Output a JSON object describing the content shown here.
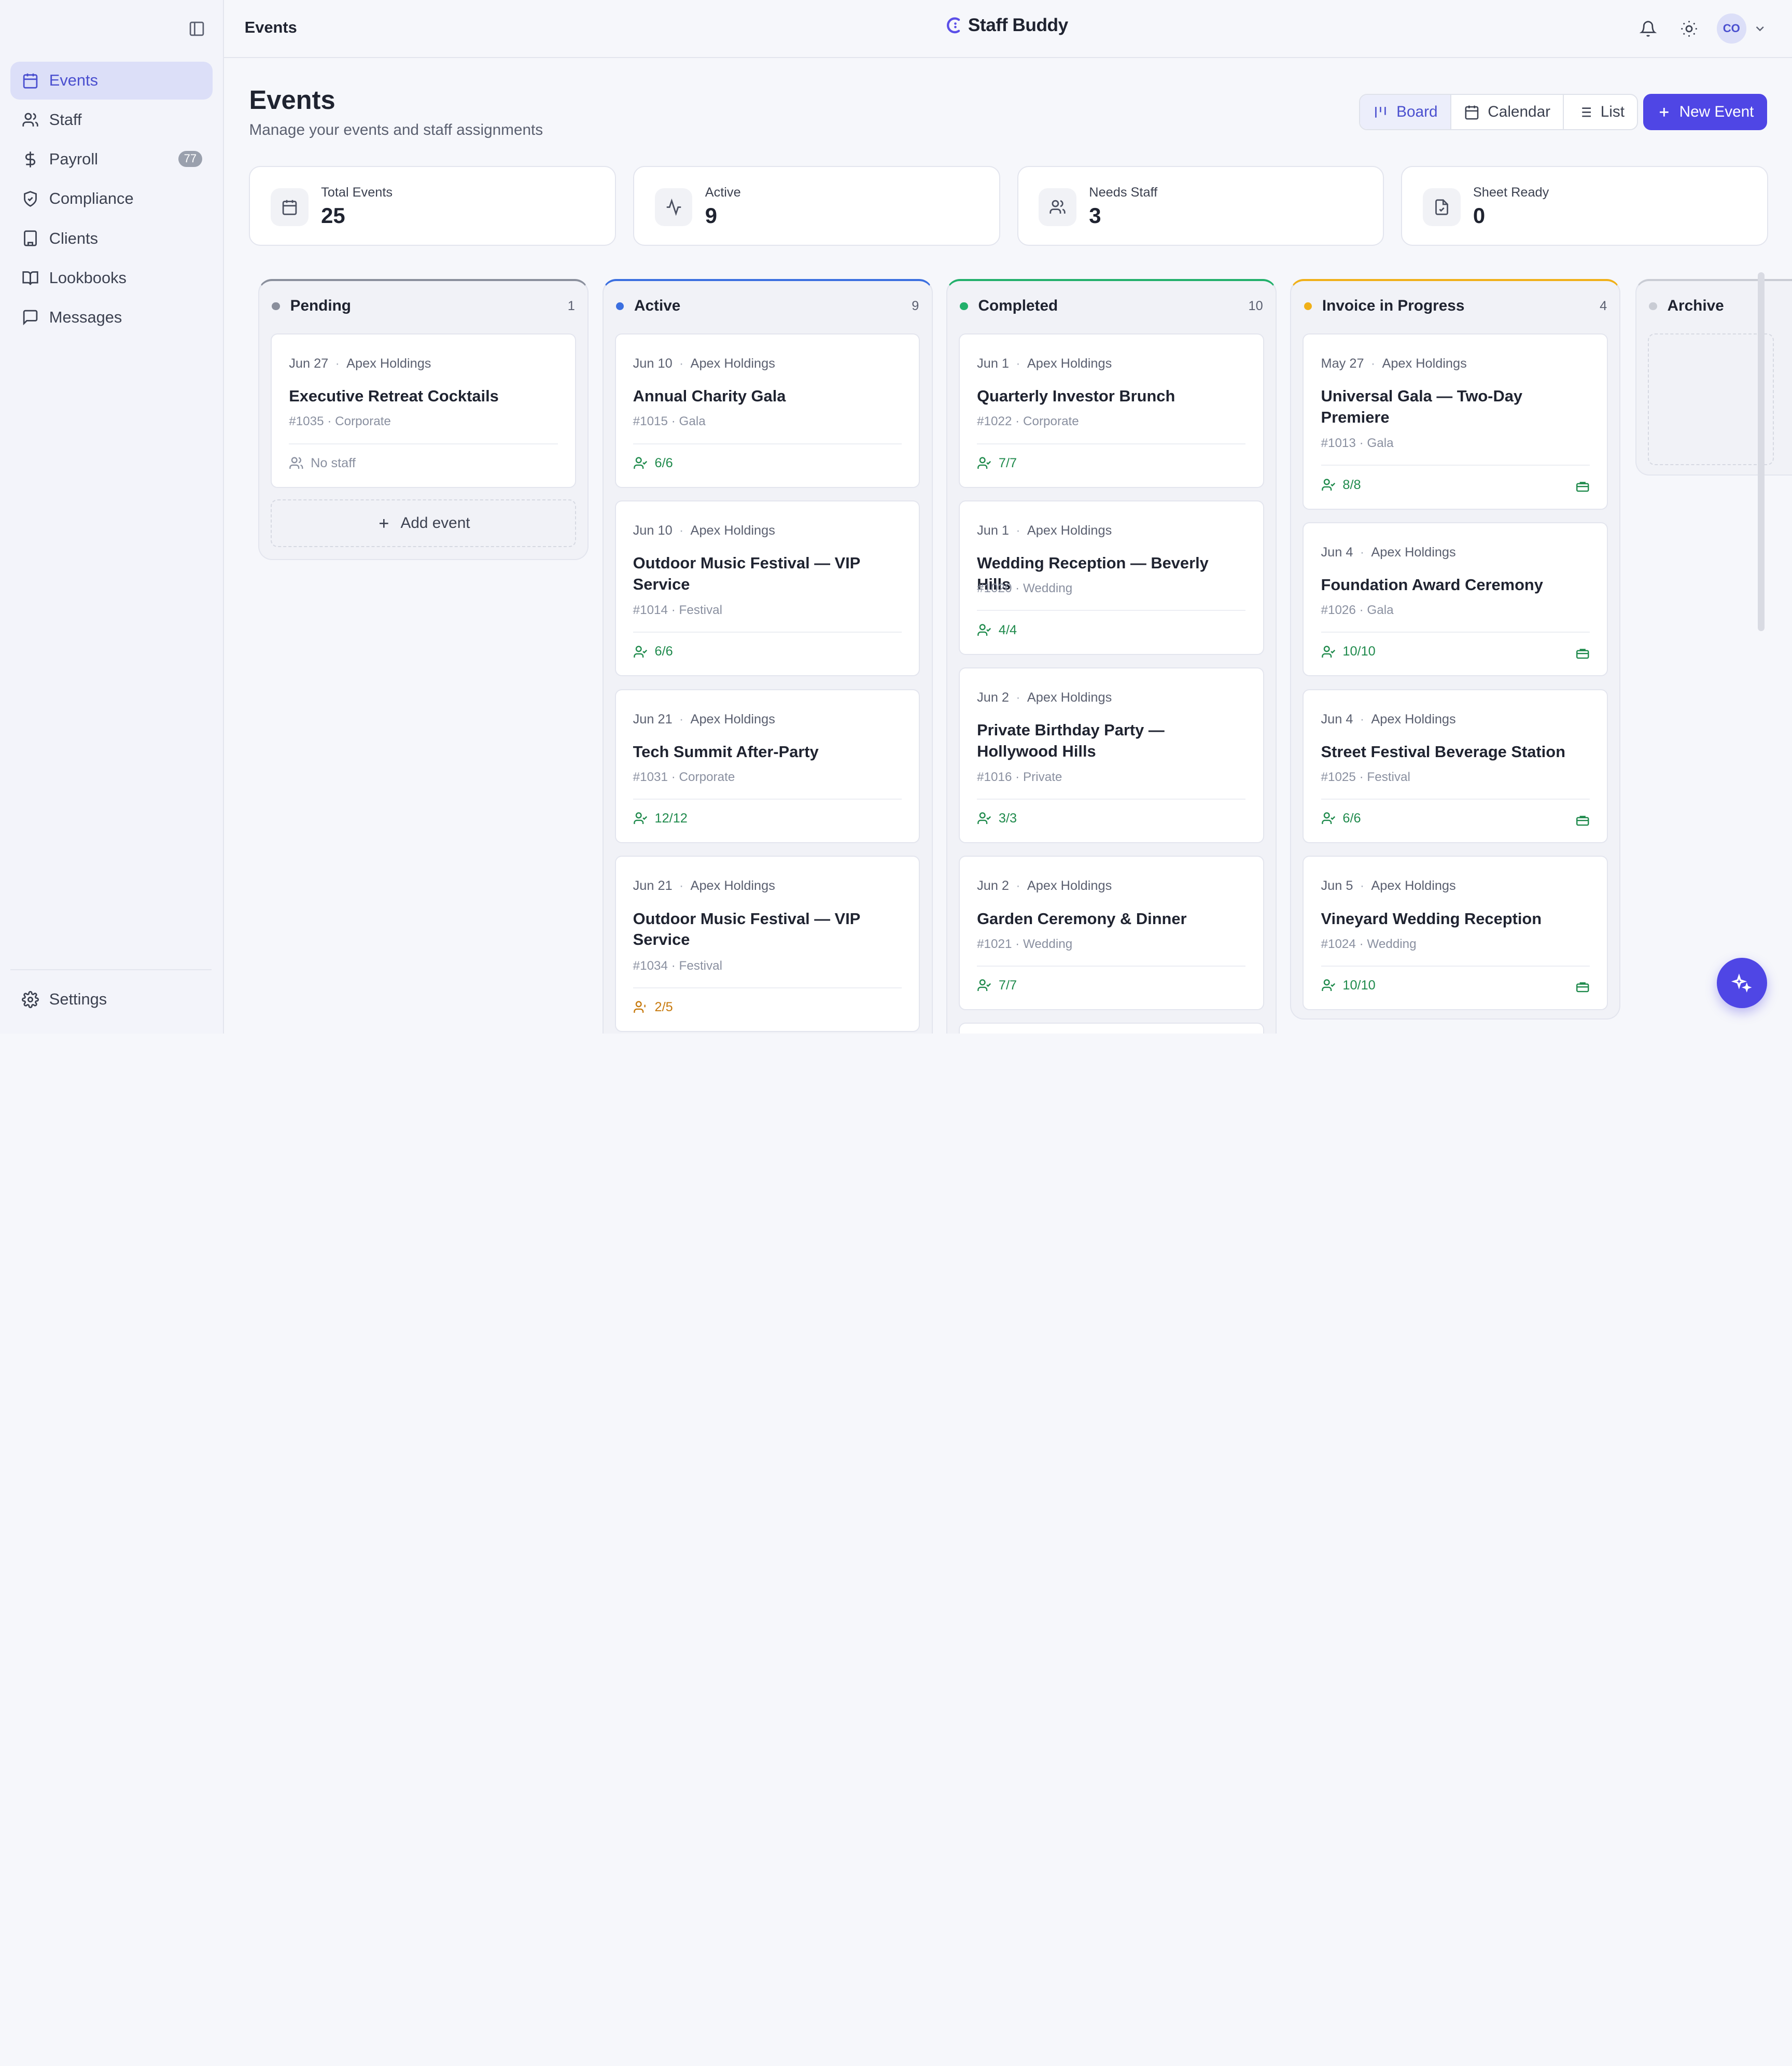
{
  "topbar": {
    "title": "Events",
    "brand": "Staff Buddy",
    "avatar_initials": "CO"
  },
  "sidebar": {
    "items": [
      {
        "label": "Events",
        "icon": "calendar-icon",
        "active": true
      },
      {
        "label": "Staff",
        "icon": "users-icon"
      },
      {
        "label": "Payroll",
        "icon": "dollar-icon",
        "badge": "77"
      },
      {
        "label": "Compliance",
        "icon": "shield-icon"
      },
      {
        "label": "Clients",
        "icon": "building-icon"
      },
      {
        "label": "Lookbooks",
        "icon": "book-icon"
      },
      {
        "label": "Messages",
        "icon": "message-icon"
      }
    ],
    "settings_label": "Settings"
  },
  "header": {
    "title": "Events",
    "subtitle": "Manage your events and staff assignments",
    "views": [
      "Board",
      "Calendar",
      "List"
    ],
    "active_view": "Board",
    "new_event_label": "New Event"
  },
  "stats": [
    {
      "label": "Total Events",
      "value": "25",
      "icon": "calendar-icon"
    },
    {
      "label": "Active",
      "value": "9",
      "icon": "activity-icon"
    },
    {
      "label": "Needs Staff",
      "value": "3",
      "icon": "users-icon"
    },
    {
      "label": "Sheet Ready",
      "value": "0",
      "icon": "file-check-icon"
    }
  ],
  "colors": {
    "accent": "#4f46e5",
    "pending": "#8a8f9c",
    "active": "#3b6fe0",
    "completed": "#22b06b",
    "invoice": "#f0b019",
    "archive": "#c9ccd4"
  },
  "board": {
    "add_event_label": "Add event",
    "columns": [
      {
        "name": "Pending",
        "count": "1",
        "cards": [
          {
            "date": "Jun 27",
            "client": "Apex Holdings",
            "title": "Executive Retreat Cocktails",
            "sub": "#1035 · Corporate",
            "staff": "No staff",
            "staff_state": "none"
          }
        ]
      },
      {
        "name": "Active",
        "count": "9",
        "cards": [
          {
            "date": "Jun 10",
            "client": "Apex Holdings",
            "title": "Annual Charity Gala",
            "sub": "#1015 · Gala",
            "staff": "6/6",
            "staff_state": "ok"
          },
          {
            "date": "Jun 10",
            "client": "Apex Holdings",
            "title": "Outdoor Music Festival — VIP Service",
            "sub": "#1014 · Festival",
            "staff": "6/6",
            "staff_state": "ok"
          },
          {
            "date": "Jun 21",
            "client": "Apex Holdings",
            "title": "Tech Summit After-Party",
            "sub": "#1031 · Corporate",
            "staff": "12/12",
            "staff_state": "ok"
          },
          {
            "date": "Jun 21",
            "client": "Apex Holdings",
            "title": "Outdoor Music Festival — VIP Service",
            "sub": "#1034 · Festival",
            "staff": "2/5",
            "staff_state": "warn"
          }
        ]
      },
      {
        "name": "Completed",
        "count": "10",
        "cards": [
          {
            "date": "Jun 1",
            "client": "Apex Holdings",
            "title": "Quarterly Investor Brunch",
            "sub": "#1022 · Corporate",
            "staff": "7/7",
            "staff_state": "ok"
          },
          {
            "date": "Jun 1",
            "client": "Apex Holdings",
            "title": "Wedding Reception — Beverly Hills",
            "sub": "#1020 · Wedding",
            "staff": "4/4",
            "staff_state": "ok"
          },
          {
            "date": "Jun 2",
            "client": "Apex Holdings",
            "title": "Private Birthday Party — Hollywood Hills",
            "sub": "#1016 · Private",
            "staff": "3/3",
            "staff_state": "ok"
          },
          {
            "date": "Jun 2",
            "client": "Apex Holdings",
            "title": "Garden Ceremony & Dinner",
            "sub": "#1021 · Wedding",
            "staff": "7/7",
            "staff_state": "ok"
          }
        ]
      },
      {
        "name": "Invoice in Progress",
        "count": "4",
        "cards": [
          {
            "date": "May 27",
            "client": "Apex Holdings",
            "title": "Universal Gala — Two-Day Premiere",
            "sub": "#1013 · Gala",
            "staff": "8/8",
            "staff_state": "ok"
          },
          {
            "date": "Jun 4",
            "client": "Apex Holdings",
            "title": "Foundation Award Ceremony",
            "sub": "#1026 · Gala",
            "staff": "10/10",
            "staff_state": "ok"
          },
          {
            "date": "Jun 4",
            "client": "Apex Holdings",
            "title": "Street Festival Beverage Station",
            "sub": "#1025 · Festival",
            "staff": "6/6",
            "staff_state": "ok"
          },
          {
            "date": "Jun 5",
            "client": "Apex Holdings",
            "title": "Vineyard Wedding Reception",
            "sub": "#1024 · Wedding",
            "staff": "10/10",
            "staff_state": "ok"
          }
        ]
      },
      {
        "name": "Archive",
        "count": "",
        "cards": []
      }
    ]
  }
}
